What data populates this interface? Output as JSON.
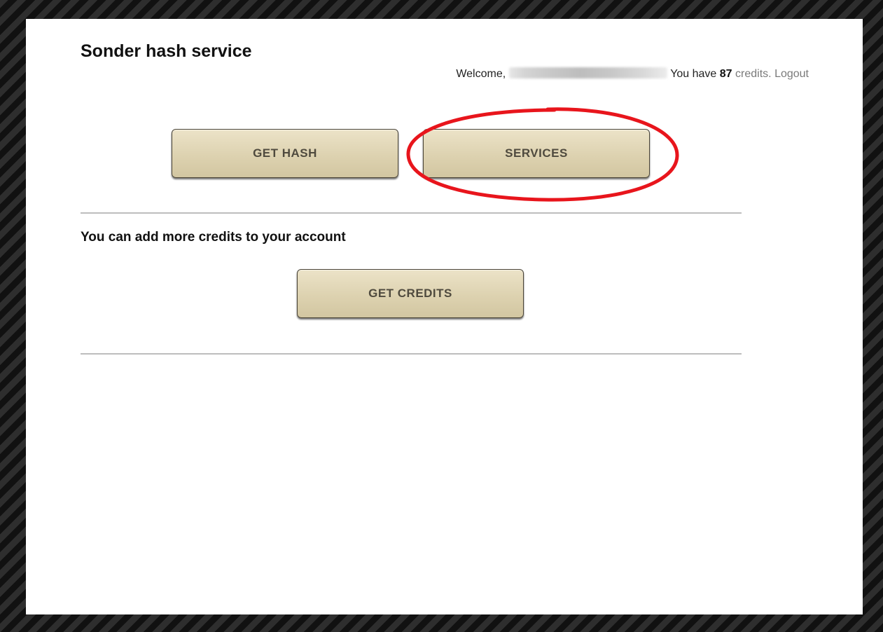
{
  "header": {
    "title": "Sonder hash service"
  },
  "userbar": {
    "welcome": "Welcome,",
    "email_redacted": "",
    "have_prefix": "You have",
    "credit_count": "87",
    "credits_link": "credits.",
    "logout_link": "Logout"
  },
  "actions": {
    "get_hash_label": "GET HASH",
    "services_label": "SERVICES"
  },
  "credits_section": {
    "message": "You can add more credits to your account",
    "get_credits_label": "GET CREDITS"
  },
  "annotation": {
    "highlight_color": "#e8151c",
    "target": "SERVICES"
  },
  "colors": {
    "button_top": "#ece3c8",
    "button_bottom": "#d2c6a1",
    "button_text": "#4f4a3e",
    "link": "#7a7a7a"
  }
}
